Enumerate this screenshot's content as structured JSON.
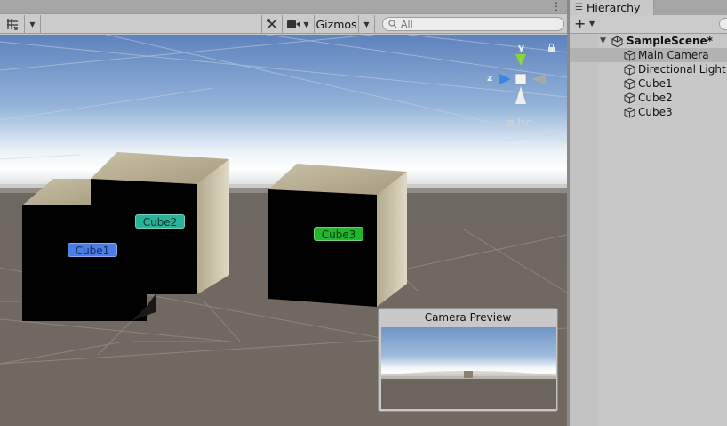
{
  "scene_toolbar": {
    "gizmos_label": "Gizmos",
    "search_placeholder": "All",
    "icons": [
      "grid-snap-icon",
      "tools-icon",
      "camera-icon",
      "search-icon",
      "kebab-menu-icon"
    ]
  },
  "viewport": {
    "objects": [
      {
        "name": "cube1-label",
        "label": "Cube1",
        "color": "#4a7de6"
      },
      {
        "name": "cube2-label",
        "label": "Cube2",
        "color": "#2bb39a"
      },
      {
        "name": "cube3-label",
        "label": "Cube3",
        "color": "#22b52e"
      }
    ],
    "axis_labels": {
      "y": "y",
      "z": "z"
    },
    "projection_label": "Iso",
    "sky_color": "#6f95c8",
    "ground_color": "#6a625b"
  },
  "camera_preview": {
    "title": "Camera Preview"
  },
  "hierarchy": {
    "tab_label": "Hierarchy",
    "scene_name": "SampleScene*",
    "items": [
      {
        "label": "Main Camera",
        "selected": true
      },
      {
        "label": "Directional Light",
        "selected": false
      },
      {
        "label": "Cube1",
        "selected": false
      },
      {
        "label": "Cube2",
        "selected": false
      },
      {
        "label": "Cube3",
        "selected": false
      }
    ]
  }
}
